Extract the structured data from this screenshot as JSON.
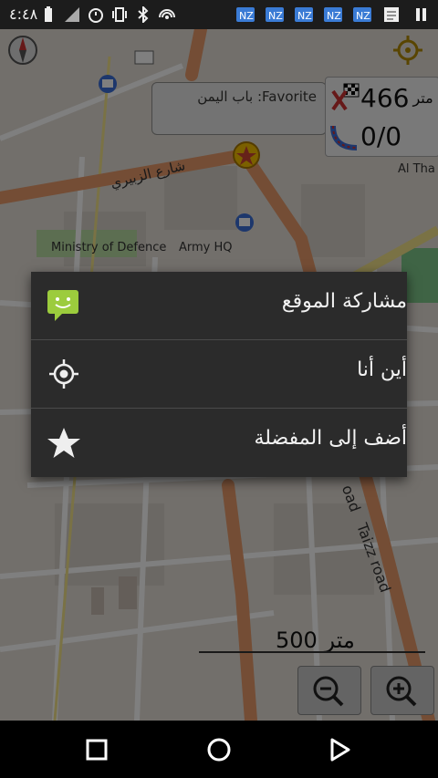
{
  "status_bar": {
    "time": "٤:٤٨",
    "left_icons": [
      "battery-icon",
      "signal-icon",
      "alarm-icon",
      "vibrate-icon",
      "bluetooth-icon",
      "hotspot-icon"
    ],
    "notification_icons": [
      "app-notification-icon",
      "app-notification-icon",
      "app-notification-icon",
      "app-notification-icon",
      "app-notification-icon",
      "news-icon",
      "pause-icon"
    ]
  },
  "map": {
    "street_label_1": "شارع الزبيري",
    "label_ministry": "Ministry of Defence",
    "label_army": "Army HQ",
    "label_al_tha": "Al Tha",
    "road_label": "Taizz road",
    "road_label_2": "oad"
  },
  "favorite_popup": {
    "text": "باب اليمن :Favorite"
  },
  "info_panel": {
    "distance_value": "466",
    "distance_unit": "متر",
    "ratio": "0/0"
  },
  "scale_bar": {
    "value": "500",
    "unit": "متر"
  },
  "context_menu": {
    "items": [
      {
        "label": "مشاركة الموقع",
        "icon": "share-message-icon"
      },
      {
        "label": "أين أنا",
        "icon": "my-location-icon"
      },
      {
        "label": "أضف إلى المفضلة",
        "icon": "star-icon"
      }
    ]
  },
  "zoom": {
    "zoom_out_icon": "zoom-out-icon",
    "zoom_in_icon": "zoom-in-icon"
  },
  "nav_bar": {
    "icons": [
      "recents-icon",
      "home-icon",
      "back-icon"
    ]
  },
  "colors": {
    "menu_bg": "#2b2b2b",
    "map_bg": "#e6e0d8",
    "road_orange": "#e89a6a",
    "road_yellow": "#f4e58a",
    "park_green": "#b9dca3",
    "accent_green": "#9ccc3d"
  }
}
